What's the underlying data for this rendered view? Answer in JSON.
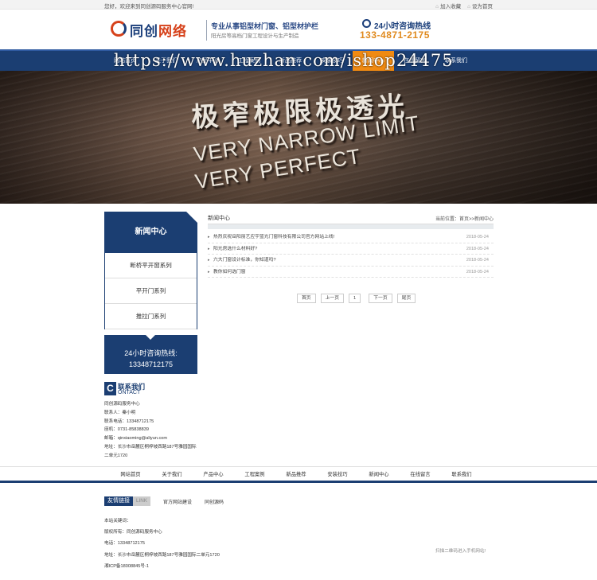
{
  "topbar": {
    "welcome": "您好，欢迎来到同创源码服务中心官网!",
    "add_favorite": "加入收藏",
    "set_home": "设为首页"
  },
  "header": {
    "logo_text_a": "同创",
    "logo_text_b": "网络",
    "tagline": "专业从事铝型材门窗、铝型材护栏",
    "subtagline": "阳光房等高档门窗工程设计与生产制造",
    "hotline_label": "24小时咨询热线",
    "hotline_number": "133-4871-2175"
  },
  "watermark": "https://www.huzhan.com/ishop24475",
  "nav": {
    "items": [
      "网站首页",
      "关于我们",
      "产品中心",
      "工程案例",
      "新品推荐",
      "安装技巧",
      "新闻中心",
      "在线留言",
      "联系我们"
    ],
    "active_index": 6
  },
  "banner": {
    "line1": "极窄极限极透光",
    "line2": "VERY NARROW LIMIT",
    "line3": "VERY PERFECT"
  },
  "sidebar": {
    "title": "新闻中心",
    "items": [
      "断桥平开窗系列",
      "平开门系列",
      "推拉门系列"
    ],
    "hotline_label": "24小时咨询热线:",
    "hotline_number": "13348712175"
  },
  "contact": {
    "icon_letter": "C",
    "title": "联系我们",
    "subtitle": "ONTACT",
    "lines": [
      "同创源码服务中心",
      "联系人：秦小明",
      "联系电话：13348712175",
      "座机：0731-85838839",
      "邮箱：qinxiaoming@aliyun.com",
      "地址：长沙市岳麓区桐梓坡西路187号雅园国际",
      "二单元1720"
    ]
  },
  "main": {
    "title": "新闻中心",
    "breadcrumb": "当前位置：首页>>新闻中心",
    "news": [
      {
        "title": "热烈庆祝岳阳丽艺应宇蓝光门窗科技有限公司官方网站上线!",
        "date": "2018-05-24"
      },
      {
        "title": "阳光房选什么材料好?",
        "date": "2018-05-24"
      },
      {
        "title": "六大门窗设计标准，你知道吗?",
        "date": "2018-05-24"
      },
      {
        "title": "教你如何选门窗",
        "date": "2018-05-24"
      }
    ],
    "pager": {
      "first": "首页",
      "prev": "上一页",
      "current": "1",
      "next": "下一页",
      "last": "尾页"
    }
  },
  "footer_nav": {
    "items": [
      "网站首页",
      "关于我们",
      "产品中心",
      "工程案例",
      "新品推荐",
      "安装技巧",
      "新闻中心",
      "在线留言",
      "联系我们"
    ]
  },
  "footer": {
    "links_label": "友情链接",
    "links_label_en": "LINK",
    "links": [
      "官方网站建设",
      "同创源码"
    ],
    "info": [
      "本站关键词：",
      "版权所有：同创源码服务中心",
      "电话：13348712175",
      "地址：长沙市岳麓区桐梓坡西路187号雅园国际二单元1720",
      "湘ICP备18008845号-1"
    ],
    "qr_text": "扫描二维码进入手机网站!"
  }
}
